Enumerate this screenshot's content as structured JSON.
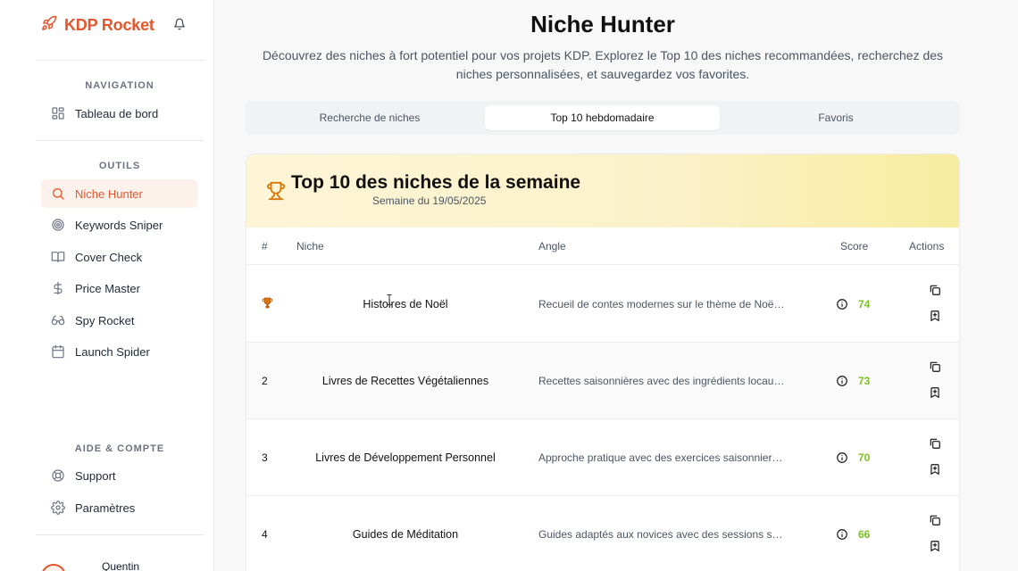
{
  "brand": {
    "name": "KDP Rocket"
  },
  "sidebar": {
    "sections": {
      "navigation": "NAVIGATION",
      "tools": "OUTILS",
      "help": "AIDE & COMPTE"
    },
    "navigation": [
      {
        "label": "Tableau de bord",
        "icon": "dashboard-icon"
      }
    ],
    "tools": [
      {
        "label": "Niche Hunter",
        "icon": "search-icon",
        "active": true
      },
      {
        "label": "Keywords Sniper",
        "icon": "target-icon"
      },
      {
        "label": "Cover Check",
        "icon": "book-open-icon"
      },
      {
        "label": "Price Master",
        "icon": "dollar-icon"
      },
      {
        "label": "Spy Rocket",
        "icon": "glasses-icon"
      },
      {
        "label": "Launch Spider",
        "icon": "calendar-icon"
      }
    ],
    "help": [
      {
        "label": "Support",
        "icon": "lifebuoy-icon"
      },
      {
        "label": "Paramètres",
        "icon": "gear-icon"
      }
    ],
    "user": {
      "name": "Quentin"
    }
  },
  "main": {
    "title": "Niche Hunter",
    "description": "Découvrez des niches à fort potentiel pour vos projets KDP. Explorez le Top 10 des niches recommandées, recherchez des niches personnalisées, et sauvegardez vos favorites.",
    "tabs": [
      {
        "label": "Recherche de niches",
        "active": false
      },
      {
        "label": "Top 10 hebdomadaire",
        "active": true
      },
      {
        "label": "Favoris",
        "active": false
      }
    ]
  },
  "card": {
    "title": "Top 10 des niches de la semaine",
    "subtitle": "Semaine du 19/05/2025",
    "columns": {
      "rank": "#",
      "niche": "Niche",
      "angle": "Angle",
      "score": "Score",
      "actions": "Actions"
    },
    "rows": [
      {
        "rank": "",
        "rank_icon": "trophy-icon",
        "niche": "Histoires de Noël",
        "angle": "Recueil de contes modernes sur le thème de Noë…",
        "score": "74"
      },
      {
        "rank": "2",
        "niche": "Livres de Recettes Végétaliennes",
        "angle": "Recettes saisonnières avec des ingrédients locau…",
        "score": "73"
      },
      {
        "rank": "3",
        "niche": "Livres de Développement Personnel",
        "angle": "Approche pratique avec des exercices saisonnier…",
        "score": "70"
      },
      {
        "rank": "4",
        "niche": "Guides de Méditation",
        "angle": "Guides adaptés aux novices avec des sessions s…",
        "score": "66"
      }
    ]
  },
  "colors": {
    "accent": "#e4572e",
    "score": "#7cbf26",
    "header_bg": "#fbf1c9"
  }
}
